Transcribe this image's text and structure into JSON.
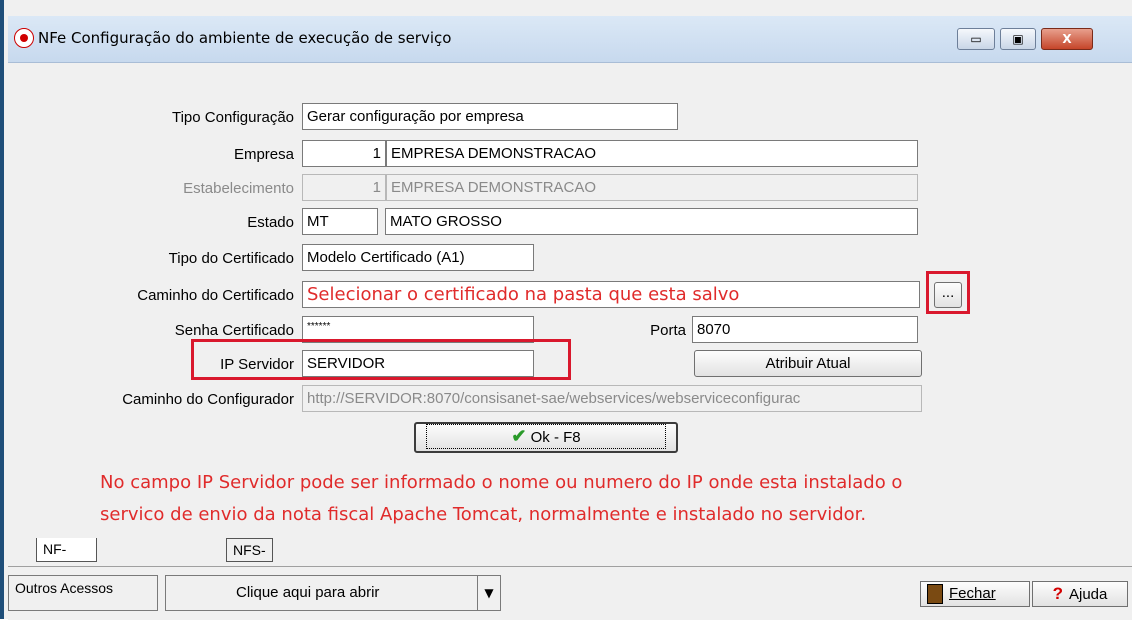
{
  "window": {
    "title": "NFe Configuração do ambiente de execução de serviço",
    "minimize_glyph": "▭",
    "maximize_glyph": "▣",
    "close_glyph": "X"
  },
  "form": {
    "tipo_configuracao": {
      "label": "Tipo Configuração",
      "value": "Gerar configuração por empresa"
    },
    "empresa": {
      "label": "Empresa",
      "code": "1",
      "name": "EMPRESA DEMONSTRACAO"
    },
    "estabelecimento": {
      "label": "Estabelecimento",
      "code": "1",
      "name": "EMPRESA DEMONSTRACAO"
    },
    "estado": {
      "label": "Estado",
      "code": "MT",
      "name": "MATO GROSSO"
    },
    "tipo_certificado": {
      "label": "Tipo do Certificado",
      "value": "Modelo Certificado (A1)"
    },
    "caminho_certificado": {
      "label": "Caminho do Certificado",
      "annotation": "Selecionar o certificado na pasta que esta salvo",
      "browse_label": "..."
    },
    "senha_certificado": {
      "label": "Senha Certificado",
      "value": "******"
    },
    "porta": {
      "label": "Porta",
      "value": "8070"
    },
    "ip_servidor": {
      "label": "IP Servidor",
      "value": "SERVIDOR"
    },
    "atribuir_atual": {
      "label": "Atribuir Atual"
    },
    "caminho_configurador": {
      "label": "Caminho do Configurador",
      "value": "http://SERVIDOR:8070/consisanet-sae/webservices/webserviceconfigurac"
    },
    "ok_button": {
      "label": "Ok - F8"
    }
  },
  "note": {
    "line1": "No campo IP Servidor pode ser informado o nome ou numero do IP onde esta instalado o",
    "line2": "servico de envio da nota fiscal Apache Tomcat, normalmente e instalado no servidor."
  },
  "tabs": [
    "NF-e/NFC-e/MDF-e",
    "NFS-e"
  ],
  "bottom": {
    "outros_label": "Outros Acessos",
    "outros_value": "Clique aqui para abrir",
    "fechar_label": "Fechar",
    "ajuda_label": "Ajuda"
  },
  "colors": {
    "annotation_red": "#e02b2b",
    "highlight_box": "#d9182d",
    "title_gradient": "#c7d9ee"
  }
}
